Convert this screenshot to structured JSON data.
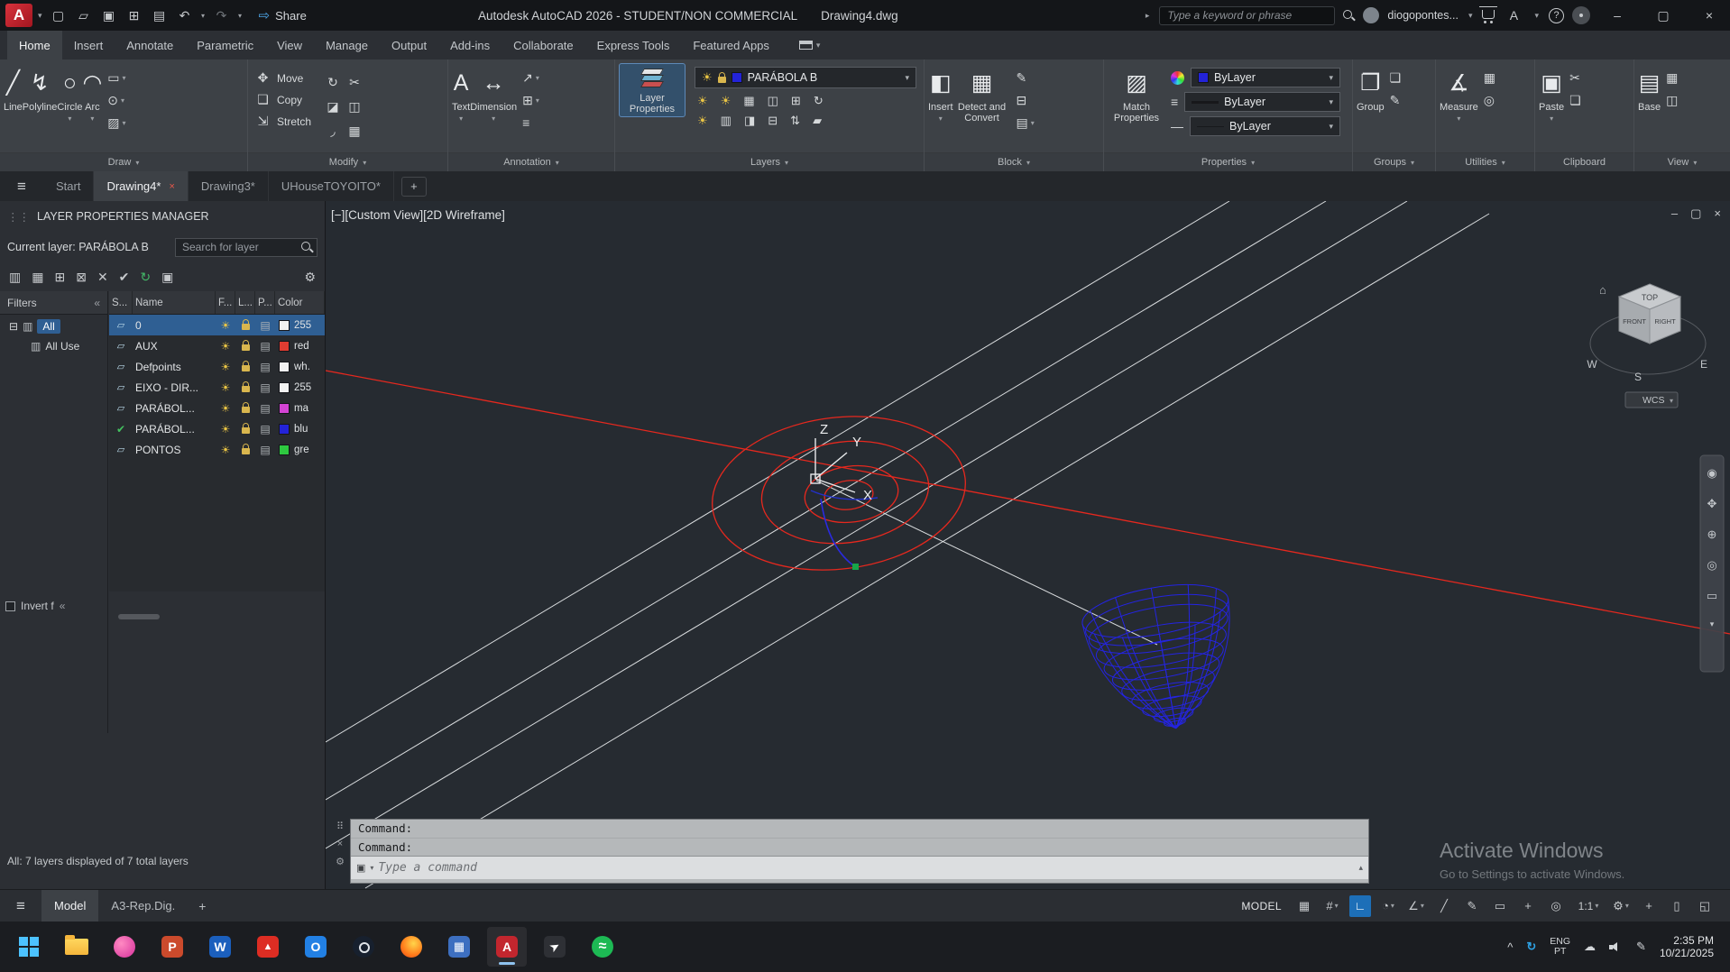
{
  "colors": {
    "accent": "#1d6fb8",
    "autocad_red": "#c2262e",
    "selection": "#2f5f93",
    "wire_blue": "#2424e2",
    "line_red": "#e6281e",
    "canvas_bg": "#262b31"
  },
  "glyphs": {
    "caret": "▾",
    "caret_up": "▴",
    "menu": "≡",
    "close": "×",
    "min": "–",
    "restore": "▢",
    "grip": "⋮⋮",
    "dots": "⠿",
    "gear": "⚙",
    "refresh": "↻",
    "check": "✔",
    "sun": "☀",
    "printer": "▤",
    "sheet": "▱",
    "expander": "⊟",
    "folder": "▥",
    "chevrons": "«",
    "undo": "↶",
    "redo": "↷",
    "share": "⇨",
    "arrow": "▸",
    "help": "?",
    "launcher": "↘"
  },
  "titlebar": {
    "logo": "A",
    "share": "Share",
    "title": "Autodesk AutoCAD 2026 - STUDENT/NON COMMERCIAL",
    "doc": "Drawing4.dwg",
    "search_placeholder": "Type a keyword or phrase",
    "user": "diogopontes...",
    "icons": {
      "new": "▢",
      "open": "▱",
      "save": "▣",
      "save_as": "⊞",
      "print": "▤"
    }
  },
  "ribbon": {
    "tabs": [
      "Home",
      "Insert",
      "Annotate",
      "Parametric",
      "View",
      "Manage",
      "Output",
      "Add-ins",
      "Collaborate",
      "Express Tools",
      "Featured Apps"
    ],
    "draw": {
      "label": "Draw",
      "items": {
        "line": "Line",
        "polyline": "Polyline",
        "circle": "Circle",
        "arc": "Arc"
      },
      "ic": {
        "line": "╱",
        "polyline": "↯",
        "circle": "○",
        "arc": "◠",
        "r1": "▭",
        "r2": "⊙",
        "r3": "▨"
      }
    },
    "modify": {
      "label": "Modify",
      "items": {
        "move": "Move",
        "copy": "Copy",
        "stretch": "Stretch"
      },
      "ic": {
        "move": "✥",
        "copy": "❏",
        "stretch": "⇲",
        "g1": "↻",
        "g2": "✂",
        "g3": "◪",
        "g4": "◫",
        "g5": "◞",
        "g6": "▦"
      }
    },
    "annotation": {
      "label": "Annotation",
      "items": {
        "text": "Text",
        "dimension": "Dimension"
      },
      "ic": {
        "text": "A",
        "dimension": "↔",
        "s1": "↗",
        "s2": "⊞",
        "s3": "≡"
      }
    },
    "layers": {
      "label": "Layers",
      "big": "Layer Properties",
      "value": "PARÁBOLA B",
      "sw_style": "background:#2323d8",
      "r1": [
        "☀",
        "☀",
        "▦",
        "◫",
        "⊞",
        "↻"
      ],
      "r2": [
        "☀",
        "▥",
        "◨",
        "⊟",
        "⇅",
        "▰"
      ]
    },
    "block": {
      "label": "Block",
      "insert": "Insert",
      "detect": "Detect and Convert",
      "ic": {
        "insert": "◧",
        "detect": "▦",
        "s1": "✎",
        "s2": "⊟",
        "s3": "▤"
      }
    },
    "properties": {
      "label": "Properties",
      "big": "Match Properties",
      "big_ic": "▨",
      "color": "ByLayer",
      "lineweight": "ByLayer",
      "linetype": "ByLayer",
      "sw_style": "background:#2323d8",
      "lw_ic": "≡",
      "lt_ic": "—"
    },
    "groups": {
      "label": "Groups",
      "big": "Group",
      "big_ic": "❐",
      "s1": "❏",
      "s2": "✎"
    },
    "utilities": {
      "label": "Utilities",
      "big": "Measure",
      "big_ic": "∡",
      "s1": "▦",
      "s2": "◎"
    },
    "clipboard": {
      "label": "Clipboard",
      "big": "Paste",
      "big_ic": "▣",
      "s1": "✂",
      "s2": "❏"
    },
    "view": {
      "label": "View",
      "big": "Base",
      "big_ic": "▤",
      "s1": "▦",
      "s2": "◫"
    }
  },
  "file_tabs": {
    "tabs": [
      "Start",
      "Drawing4*",
      "Drawing3*",
      "UHouseTOYOITO*"
    ]
  },
  "palette": {
    "title": "LAYER PROPERTIES MANAGER",
    "current": "Current layer: PARÁBOLA B",
    "search_placeholder": "Search for layer",
    "filters": "Filters",
    "tree": {
      "all": "All",
      "all_used": "All Use"
    },
    "columns": [
      "S...",
      "Name",
      "F...",
      "L...",
      "P...",
      "Color"
    ],
    "rows": [
      {
        "name": "0",
        "color": "255",
        "sw_style": "background:#f2f2f2"
      },
      {
        "name": "AUX",
        "color": "red",
        "sw_style": "background:#e03c31"
      },
      {
        "name": "Defpoints",
        "color": "wh.",
        "sw_style": "background:#f2f2f2"
      },
      {
        "name": "EIXO - DIR...",
        "color": "255",
        "sw_style": "background:#f2f2f2"
      },
      {
        "name": "PARÁBOL...",
        "color": "ma",
        "sw_style": "background:#d444d4"
      },
      {
        "name": "PARÁBOL...",
        "color": "blu",
        "sw_style": "background:#2323d8"
      },
      {
        "name": "PONTOS",
        "color": "gre",
        "sw_style": "background:#2ec840"
      }
    ],
    "tools": {
      "t1": "▥",
      "t2": "▦",
      "t3": "⊞",
      "t4": "⊠",
      "t5": "✕",
      "t6": "✔",
      "toggle": "▣"
    },
    "invert": "Invert f",
    "status": "All: 7 layers displayed of 7 total layers"
  },
  "viewport": {
    "controls": "[−][Custom View][2D Wireframe]",
    "cube": {
      "top": "TOP",
      "front": "FRONT",
      "right": "RIGHT",
      "w": "W",
      "s": "S",
      "e": "E",
      "home": "⌂"
    },
    "wcs": "WCS",
    "axes": {
      "x": "X",
      "y": "Y",
      "z": "Z"
    },
    "nav": [
      "◉",
      "✥",
      "⊕",
      "◎",
      "▭",
      "▾"
    ]
  },
  "command": {
    "line1": "Command:",
    "line2": "Command:",
    "placeholder": "Type a command",
    "box_icon": "▣"
  },
  "statusbar": {
    "model_tab": "Model",
    "layout_tab": "A3-Rep.Dig.",
    "plus": "+",
    "model": "MODEL",
    "scale": "1:1",
    "icons": [
      "▦",
      "#",
      "∟",
      "◔",
      "∠",
      "╱",
      "✎",
      "▭",
      "+",
      "◎",
      "⚙",
      "+",
      "▯",
      "◱"
    ]
  },
  "taskbar": {
    "time": "2:35 PM",
    "date": "10/21/2025",
    "lang1": "ENG",
    "lang2": "PT",
    "letters": {
      "ppt": "P",
      "word": "W",
      "outlook": "O",
      "calc": "▦",
      "acad": "A",
      "acrobat": "▲",
      "cursor": "➤",
      "spotify": "≈"
    },
    "tray": {
      "chevron": "^",
      "sync": "↻",
      "cloud": "☁",
      "pen": "✎"
    }
  },
  "watermark": {
    "line1": "Activate Windows",
    "line2": "Go to Settings to activate Windows."
  }
}
